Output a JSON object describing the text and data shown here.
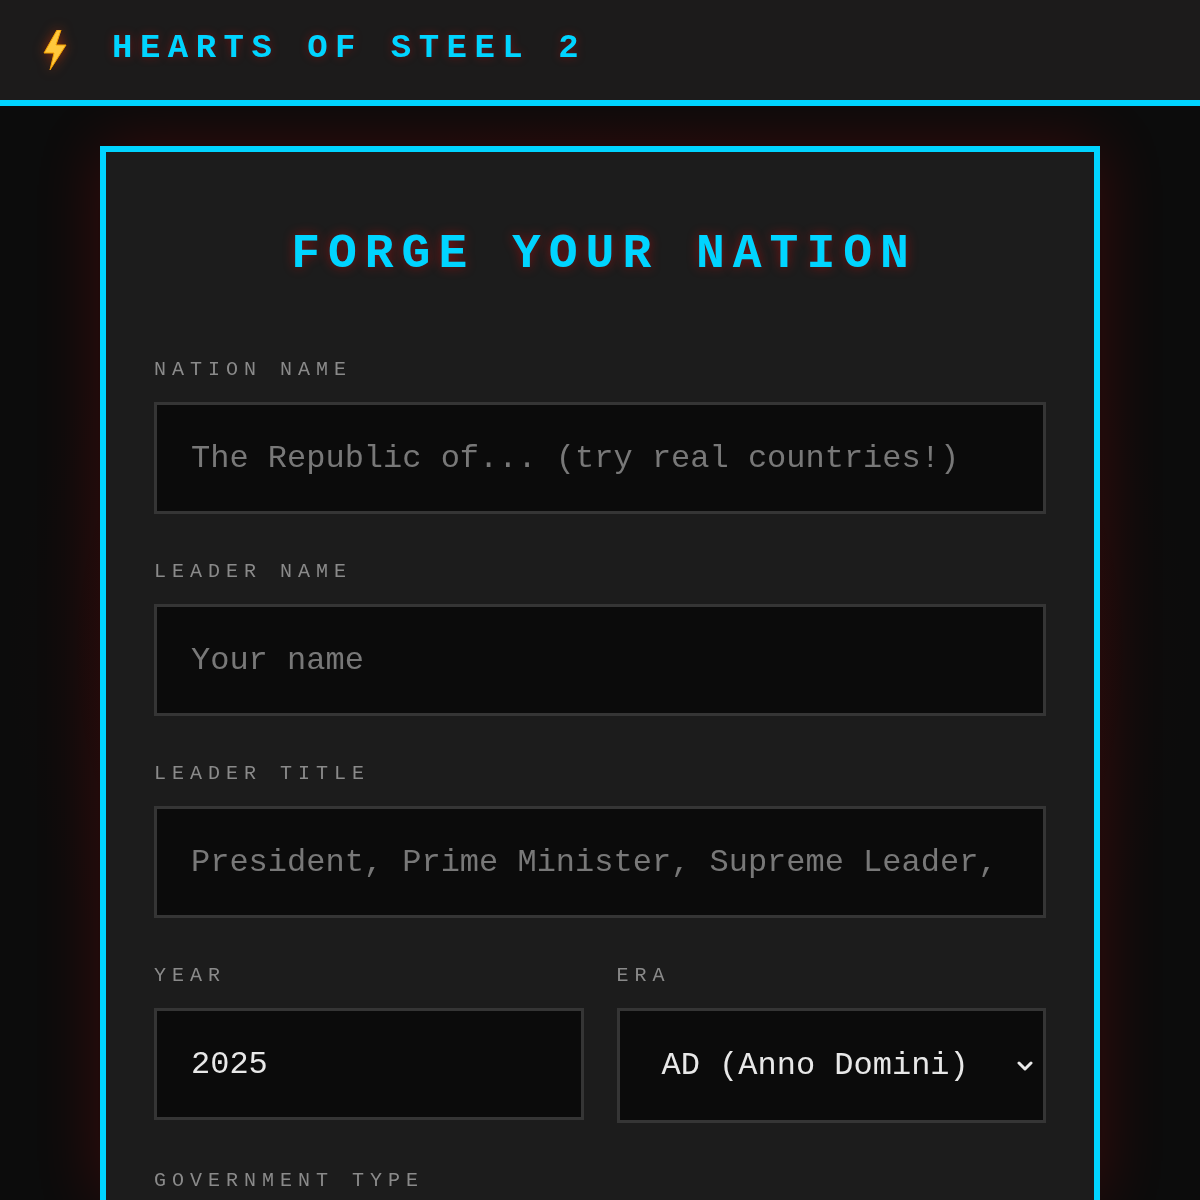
{
  "header": {
    "title": "HEARTS OF STEEL 2"
  },
  "form": {
    "title": "FORGE YOUR NATION",
    "rows": [
      [
        {
          "kind": "text",
          "label": "NATION NAME",
          "placeholder": "The Republic of... (try real countries!)"
        }
      ],
      [
        {
          "kind": "text",
          "label": "LEADER NAME",
          "placeholder": "Your name"
        }
      ],
      [
        {
          "kind": "text",
          "label": "LEADER TITLE",
          "placeholder": "President, Prime Minister, Supreme Leader,"
        }
      ],
      [
        {
          "kind": "text",
          "label": "YEAR",
          "value": "2025"
        },
        {
          "kind": "select",
          "label": "ERA",
          "value": "AD (Anno Domini)"
        }
      ],
      [
        {
          "label": "GOVERNMENT TYPE"
        }
      ]
    ]
  }
}
